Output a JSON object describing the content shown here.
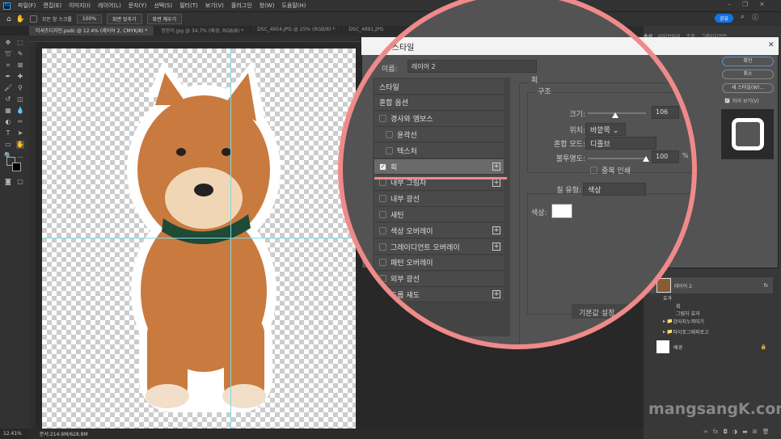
{
  "menu": [
    "파일(F)",
    "편집(E)",
    "이미지(I)",
    "레이어(L)",
    "문자(Y)",
    "선택(S)",
    "필터(T)",
    "보기(V)",
    "플러그인",
    "창(W)",
    "도움말(H)"
  ],
  "options": {
    "scroll_all": "모든 창 스크롤",
    "zoom100": "100%",
    "fit_screen": "화면 맞추기",
    "fill_screen": "화면 채우기",
    "share": "공유"
  },
  "tabs": [
    "티셔츠디자인.psdc @ 12.4% (레이어 2, CMYK/8) *",
    "멍멍이.jpg @ 34.7% (배경, RGB/8) *",
    "DSC_4954.JPG @ 25% (RGB/8) *",
    "DSC_4891.JPG"
  ],
  "status": {
    "zoom": "12.41%",
    "doc": "문서:214.9M/628.8M"
  },
  "right_tabs": [
    "속성",
    "라이브러리",
    "조정",
    "그레이디언트"
  ],
  "layers": [
    {
      "name": "레이어 2",
      "fx": "fx"
    },
    {
      "name": "효과"
    },
    {
      "name": "획"
    },
    {
      "name": "그림자 효과"
    },
    {
      "name": "강아지누끼따기"
    },
    {
      "name": "타이포그래피로고"
    },
    {
      "name": "배경"
    }
  ],
  "dialog": {
    "title": "레이어 스타일",
    "name_label": "이름:",
    "name_value": "레이어 2",
    "ok": "확인",
    "cancel": "취소",
    "new_style": "새 스타일(W)...",
    "preview": "미리 보기(V)",
    "styles": [
      {
        "label": "스타일",
        "checkbox": false,
        "plus": false,
        "checked": false
      },
      {
        "label": "혼합 옵션",
        "checkbox": false,
        "plus": false,
        "checked": false
      },
      {
        "label": "경사와 엠보스",
        "checkbox": true,
        "plus": false,
        "checked": false
      },
      {
        "label": "윤곽선",
        "checkbox": true,
        "plus": false,
        "checked": false,
        "indent": true
      },
      {
        "label": "텍스처",
        "checkbox": true,
        "plus": false,
        "checked": false,
        "indent": true
      },
      {
        "label": "획",
        "checkbox": true,
        "plus": true,
        "checked": true
      },
      {
        "label": "내부 그림자",
        "checkbox": true,
        "plus": true,
        "checked": false
      },
      {
        "label": "내부 광선",
        "checkbox": true,
        "plus": false,
        "checked": false
      },
      {
        "label": "새틴",
        "checkbox": true,
        "plus": false,
        "checked": false
      },
      {
        "label": "색상 오버레이",
        "checkbox": true,
        "plus": true,
        "checked": false
      },
      {
        "label": "그레이디언트 오버레이",
        "checkbox": true,
        "plus": true,
        "checked": false
      },
      {
        "label": "패턴 오버레이",
        "checkbox": true,
        "plus": false,
        "checked": false
      },
      {
        "label": "외부 광선",
        "checkbox": true,
        "plus": false,
        "checked": false
      },
      {
        "label": "드롭 섀도",
        "checkbox": true,
        "plus": true,
        "checked": false
      }
    ],
    "section": "획",
    "structure": "구조",
    "size_label": "크기:",
    "size_value": "106",
    "position_label": "위치:",
    "position_value": "바깥쪽",
    "blend_label": "혼합 모드:",
    "blend_value": "디졸브",
    "opacity_label": "불투명도:",
    "opacity_value": "100",
    "opacity_unit": "%",
    "overprint": "중복 인쇄",
    "fill_label": "칠 유형:",
    "fill_value": "색상",
    "color_label": "색상:",
    "color_value": "#ffffff",
    "default_btn": "기본값 설정"
  },
  "accent": "#f08a8a",
  "watermark": "mangsangK.com"
}
